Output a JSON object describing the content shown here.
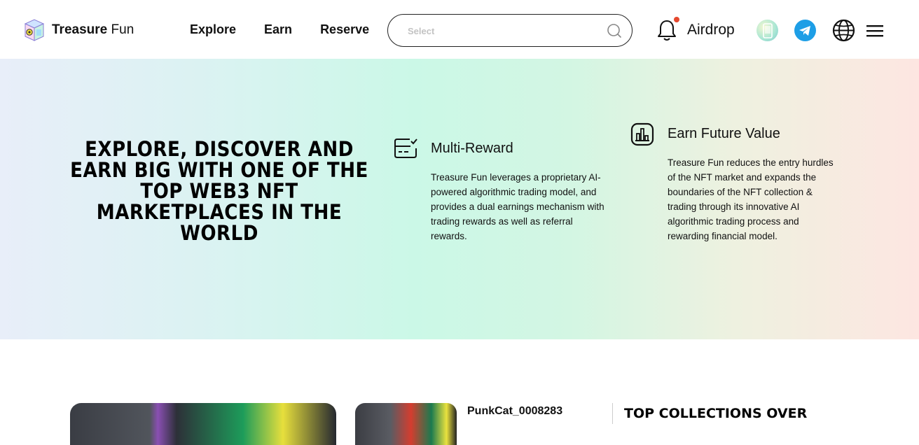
{
  "header": {
    "logo_text_bold": "Treasure",
    "logo_text_light": "Fun",
    "nav": [
      {
        "label": "Explore"
      },
      {
        "label": "Earn"
      },
      {
        "label": "Reserve"
      }
    ],
    "search": {
      "placeholder": "Select",
      "value": ""
    },
    "airdrop_label": "Airdrop",
    "icons": [
      "bell-icon",
      "app-icon",
      "telegram-icon",
      "globe-icon",
      "menu-icon"
    ]
  },
  "hero": {
    "title": "EXPLORE, DISCOVER AND EARN BIG WITH ONE OF THE TOP WEB3 NFT MARKETPLACES IN THE WORLD",
    "features": [
      {
        "icon": "card-check-icon",
        "title": "Multi-Reward",
        "text": "Treasure Fun leverages a proprietary AI-powered algorithmic trading model, and provides a dual earnings mechanism with trading rewards as well as referral rewards."
      },
      {
        "icon": "chart-box-icon",
        "title": "Earn Future Value",
        "text": "Treasure Fun reduces the entry hurdles of the NFT market and expands the boundaries of the NFT collection & trading through its innovative AI algorithmic trading process and rewarding financial model."
      }
    ]
  },
  "lower": {
    "featured_name": "PunkCat_0008283",
    "section_title": "TOP COLLECTIONS OVER"
  },
  "colors": {
    "notification_dot": "#e5482e",
    "telegram_blue": "#1d9ee6"
  }
}
